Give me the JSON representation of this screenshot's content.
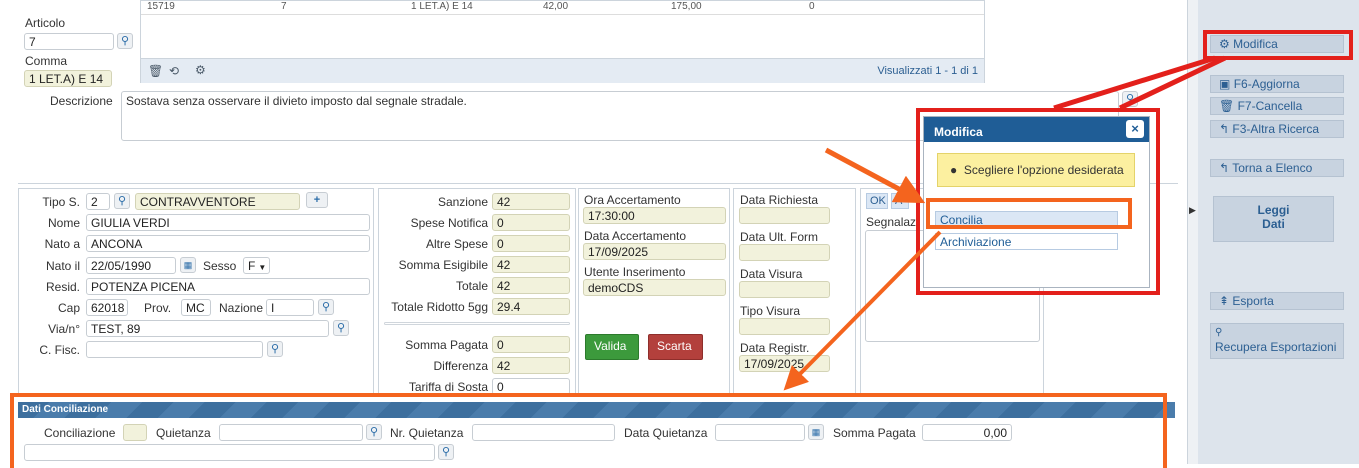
{
  "top_grid": {
    "row": [
      "15719",
      "7",
      "1 LET.A) E 14",
      "42,00",
      "175,00",
      "0"
    ],
    "footer_text": "Visualizzati 1 - 1 di 1"
  },
  "left_top": {
    "articolo_label": "Articolo",
    "articolo_value": "7",
    "comma_label": "Comma",
    "comma_value": "1 LET.A) E 14",
    "descrizione_label": "Descrizione",
    "descrizione_value": "Sostava senza osservare il divieto imposto dal segnale stradale."
  },
  "soggetto": {
    "tipo_label": "Tipo S.",
    "tipo_value": "2",
    "tipo_desc": "CONTRAVVENTORE",
    "nome_label": "Nome",
    "nome_value": "GIULIA VERDI",
    "nato_a_label": "Nato a",
    "nato_a_value": "ANCONA",
    "nato_il_label": "Nato il",
    "nato_il_value": "22/05/1990",
    "sesso_label": "Sesso",
    "sesso_value": "F",
    "resid_label": "Resid.",
    "resid_value": "POTENZA PICENA",
    "cap_label": "Cap",
    "cap_value": "62018",
    "prov_label": "Prov.",
    "prov_value": "MC",
    "nazione_label": "Nazione",
    "nazione_value": "I",
    "via_label": "Via/n°",
    "via_value": "TEST, 89",
    "cfisc_label": "C. Fisc.",
    "cfisc_value": ""
  },
  "importi": {
    "sanzione_label": "Sanzione",
    "sanzione_value": "42",
    "spese_notifica_label": "Spese Notifica",
    "spese_notifica_value": "0",
    "altre_spese_label": "Altre Spese",
    "altre_spese_value": "0",
    "somma_esigibile_label": "Somma Esigibile",
    "somma_esigibile_value": "42",
    "totale_label": "Totale",
    "totale_value": "42",
    "totale_ridotto_label": "Totale Ridotto 5gg",
    "totale_ridotto_value": "29.4",
    "somma_pagata_label": "Somma Pagata",
    "somma_pagata_value": "0",
    "differenza_label": "Differenza",
    "differenza_value": "42",
    "tariffa_label": "Tariffa di Sosta",
    "tariffa_value": "0"
  },
  "accertamento": {
    "ora_label": "Ora Accertamento",
    "ora_value": "17:30:00",
    "data_label": "Data Accertamento",
    "data_value": "17/09/2025",
    "utente_label": "Utente Inserimento",
    "utente_value": "demoCDS",
    "valida_label": "Valida",
    "scarta_label": "Scarta"
  },
  "richiesta": {
    "data_richiesta_label": "Data Richiesta",
    "data_ult_label": "Data Ult. Form",
    "data_visura_label": "Data Visura",
    "tipo_visura_label": "Tipo Visura",
    "data_registr_label": "Data Registr.",
    "data_registr_value": "17/09/2025"
  },
  "segnalazioni": {
    "ok_label": "OK",
    "a_label": "A",
    "label": "Segnalaz"
  },
  "modal": {
    "title": "Modifica",
    "close": "×",
    "message": "Scegliere l'opzione desiderata",
    "options": [
      "Concilia",
      "Archiviazione"
    ]
  },
  "conciliazione": {
    "header": "Dati Conciliazione",
    "conciliazione_label": "Conciliazione",
    "quietanza_label": "Quietanza",
    "nr_quietanza_label": "Nr. Quietanza",
    "data_quietanza_label": "Data Quietanza",
    "somma_pagata_label": "Somma Pagata",
    "somma_pagata_value": "0,00"
  },
  "sidebar": {
    "modifica": "Modifica",
    "aggiorna": "F6-Aggiorna",
    "cancella": "F7-Cancella",
    "altra_ricerca": "F3-Altra Ricerca",
    "torna": "Torna a Elenco",
    "leggi": "Leggi",
    "dati": "Dati",
    "esporta": "Esporta",
    "recupera": "Recupera Esportazioni"
  },
  "colors": {
    "accent": "#1f5d96",
    "red_highlight": "#e3201b",
    "orange_highlight": "#f4641e"
  }
}
